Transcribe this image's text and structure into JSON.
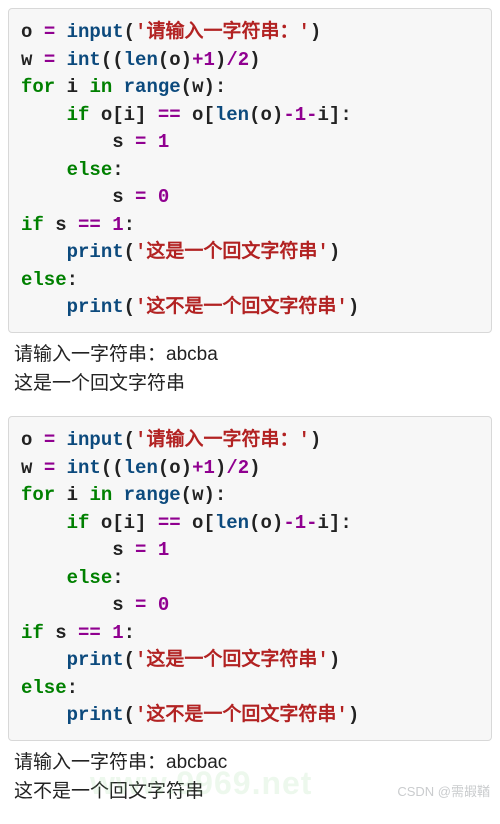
{
  "block1": {
    "l1a": "o ",
    "l1b": "= ",
    "l1c": "input",
    "l1d": "(",
    "l1e": "'请输入一字符串：'",
    "l1f": ")",
    "l2a": "w ",
    "l2b": "= ",
    "l2c": "int",
    "l2d": "((",
    "l2e": "len",
    "l2f": "(o)",
    "l2g": "+",
    "l2h": "1",
    "l2i": ")",
    "l2j": "/",
    "l2k": "2",
    "l2l": ")",
    "l3a": "for",
    "l3b": " i ",
    "l3c": "in",
    "l3d": " ",
    "l3e": "range",
    "l3f": "(w):",
    "l4a": "    ",
    "l4b": "if",
    "l4c": " o[i] ",
    "l4d": "==",
    "l4e": " o[",
    "l4f": "len",
    "l4g": "(o)",
    "l4h": "-",
    "l4i": "1",
    "l4j": "-",
    "l4k": "i]:",
    "l5a": "        s ",
    "l5b": "=",
    "l5c": " ",
    "l5d": "1",
    "l6a": "    ",
    "l6b": "else",
    "l6c": ":",
    "l7a": "        s ",
    "l7b": "=",
    "l7c": " ",
    "l7d": "0",
    "l8a": "if",
    "l8b": " s ",
    "l8c": "==",
    "l8d": " ",
    "l8e": "1",
    "l8f": ":",
    "l9a": "    ",
    "l9b": "print",
    "l9c": "(",
    "l9d": "'这是一个回文字符串'",
    "l9e": ")",
    "l10a": "else",
    "l10b": ":",
    "l11a": "    ",
    "l11b": "print",
    "l11c": "(",
    "l11d": "'这不是一个回文字符串'",
    "l11e": ")"
  },
  "output1": "请输入一字符串：abcba\n这是一个回文字符串",
  "output2": "请输入一字符串：abcbac\n这不是一个回文字符串",
  "watermark_site": "www.9969.net",
  "watermark_csdn": "CSDN @需嘏鞧"
}
